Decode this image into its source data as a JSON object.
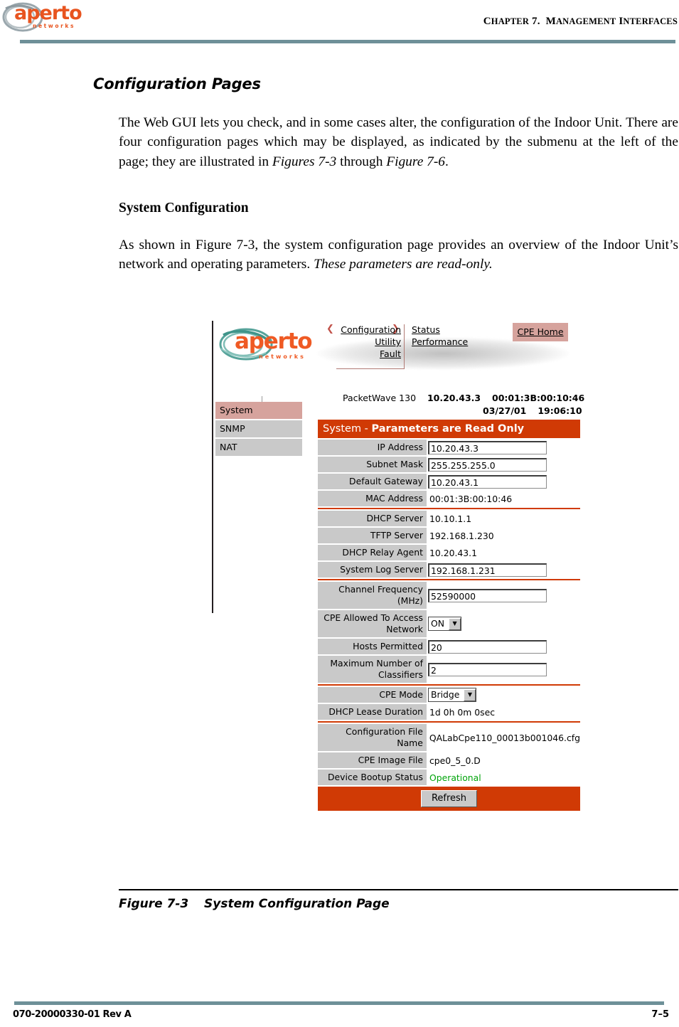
{
  "page_header": {
    "logo_word": "aperto",
    "logo_sub": "networks",
    "chapter_prefix": "C",
    "chapter_rest": "HAPTER",
    "chapter_num": "7.",
    "chapter_name_first": "M",
    "chapter_name_rest": "ANAGEMENT",
    "chapter_name2_first": "I",
    "chapter_name2_rest": "NTERFACES",
    "rule_color": "#6e9098"
  },
  "body": {
    "h1": "Configuration Pages",
    "para1_a": "The Web GUI lets you check, and in some cases alter, the configuration of the Indoor Unit. There are four configuration pages which may be displayed, as indicated by the submenu at the left of the page; they are illustrated in ",
    "para1_italic1": "Figures 7-3",
    "para1_b": " through ",
    "para1_italic2": "Figure 7-6",
    "para1_c": ".",
    "h2": "System Configuration",
    "para2_a": "As shown in Figure 7-3, the system configuration page provides an overview of the Indoor Unit’s network and operating parameters. ",
    "para2_italic": "These parameters are read-only."
  },
  "figure": {
    "rule_color": "#000000",
    "caption_number": "Figure 7-3",
    "caption_text": "System Configuration Page"
  },
  "gui": {
    "logo_word": "aperto",
    "logo_sub": "networks",
    "nav_left": [
      {
        "label": "Configuration",
        "selected": true
      },
      {
        "label": "Utility",
        "selected": false
      },
      {
        "label": "Fault",
        "selected": false
      }
    ],
    "nav_right": [
      {
        "label": "Status"
      },
      {
        "label": "Performance"
      }
    ],
    "cpe_home_label": "CPE Home",
    "cpe_home_bg": "#d6a39d",
    "device_model": "PacketWave 130",
    "device_ip": "10.20.43.3",
    "device_mac": "00:01:3B:00:10:46",
    "device_date": "03/27/01",
    "device_time": "19:06:10",
    "sidebar": [
      {
        "label": "System",
        "active": true
      },
      {
        "label": "SNMP",
        "active": false
      },
      {
        "label": "NAT",
        "active": false
      }
    ],
    "panel_title_prefix": "System - ",
    "panel_title_bold": "Parameters are Read Only",
    "panel_title_bg": "#d03a05",
    "separator_color": "#d03a05",
    "status_color": "#00a40a",
    "groups": [
      {
        "rows": [
          {
            "label": "IP Address",
            "value": "10.20.43.3",
            "kind": "input"
          },
          {
            "label": "Subnet Mask",
            "value": "255.255.255.0",
            "kind": "input"
          },
          {
            "label": "Default Gateway",
            "value": "10.20.43.1",
            "kind": "input"
          },
          {
            "label": "MAC Address",
            "value": "00:01:3B:00:10:46",
            "kind": "text"
          }
        ]
      },
      {
        "rows": [
          {
            "label": "DHCP Server",
            "value": "10.10.1.1",
            "kind": "text"
          },
          {
            "label": "TFTP Server",
            "value": "192.168.1.230",
            "kind": "text"
          },
          {
            "label": "DHCP Relay Agent",
            "value": "10.20.43.1",
            "kind": "text"
          },
          {
            "label": "System Log Server",
            "value": "192.168.1.231",
            "kind": "input"
          }
        ]
      },
      {
        "rows": [
          {
            "label": "Channel Frequency (MHz)",
            "label_line1": "Channel Frequency",
            "label_line2": "(MHz)",
            "value": "52590000",
            "kind": "input"
          },
          {
            "label": "CPE Allowed To Access Network",
            "label_line1": "CPE Allowed To Access",
            "label_line2": "Network",
            "value": "ON",
            "kind": "select"
          },
          {
            "label": "Hosts Permitted",
            "value": "20",
            "kind": "input"
          },
          {
            "label": "Maximum Number of Classifiers",
            "label_line1": "Maximum Number of",
            "label_line2": "Classifiers",
            "value": "2",
            "kind": "input"
          }
        ]
      },
      {
        "rows": [
          {
            "label": "CPE Mode",
            "value": "Bridge",
            "kind": "select"
          },
          {
            "label": "DHCP Lease Duration",
            "value": "1d 0h 0m 0sec",
            "kind": "text"
          }
        ]
      },
      {
        "rows": [
          {
            "label": "Configuration File Name",
            "label_line1": "Configuration File",
            "label_line2": "Name",
            "value": "QALabCpe110_00013b001046.cfg",
            "kind": "text"
          },
          {
            "label": "CPE Image File",
            "value": "cpe0_5_0.D",
            "kind": "text"
          },
          {
            "label": "Device Bootup Status",
            "value": "Operational",
            "kind": "text",
            "status": true
          }
        ]
      }
    ],
    "refresh_label": "Refresh",
    "dropdown_arrow_glyph": "▼"
  },
  "footer": {
    "doc_number": "070-20000330-01 Rev A",
    "page_number": "7–5",
    "rule_color": "#6e9098"
  }
}
